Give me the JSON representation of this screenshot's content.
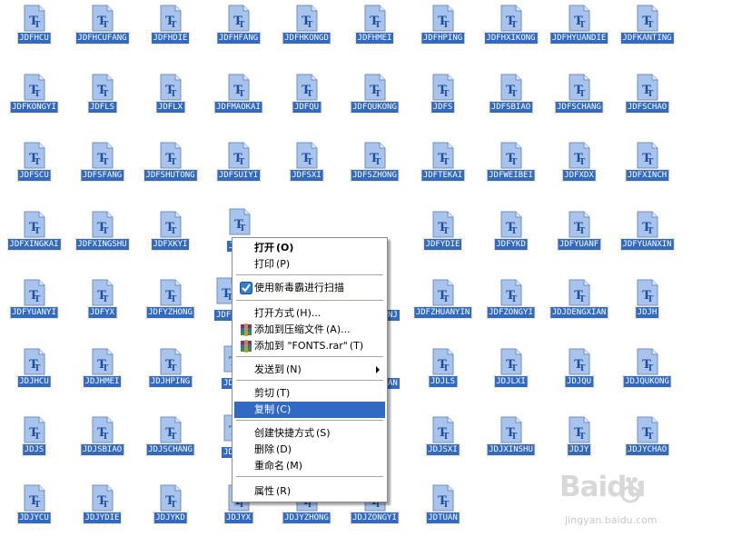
{
  "desktop": {
    "rows": [
      [
        "JDFHCU",
        "JDFHCUFANG",
        "JDFHDIE",
        "JDFHFANG",
        "JDFHKONGD",
        "JDFHMEI",
        "JDFHPING",
        "JDFHXIKONG",
        "JDFHYUANDIE",
        "JDFKANTING"
      ],
      [
        "JDFKONGYI",
        "JDFLS",
        "JDFLX",
        "JDFMAOKAI",
        "JDFQU",
        "JDFQUKONG",
        "JDFS",
        "JDFSBIAO",
        "JDFSCHANG",
        "JDFSCHAO"
      ],
      [
        "JDFSCU",
        "JDFSFANG",
        "JDFSHUTONG",
        "JDFSUIYI",
        "JDFSXI",
        "JDFSZHONG",
        "JDFTEKAI",
        "JDFWEIBEI",
        "JDFXDX",
        "JDFXINCH"
      ],
      [
        "JDFXINGKAI",
        "JDFXINGSHU",
        "JDFXKYI",
        "",
        "",
        "",
        "JDFYDIE",
        "JDFYKD",
        "JDFYUANF",
        "JDFYUANXIN"
      ],
      [
        "JDFYUANYI",
        "JDFYX",
        "JDFYZHONG",
        "",
        "",
        "",
        "JDFZHUANYIN",
        "JDFZONGYI",
        "JDJDENGXIAN",
        "JDJH"
      ],
      [
        "JDJHCU",
        "JDJHMEI",
        "JDJHPING",
        "",
        "",
        "",
        "JDJLS",
        "JDJLXI",
        "JDJQU",
        "JDJQUKONG"
      ],
      [
        "JDJS",
        "JDJSBIAO",
        "JDJSCHANG",
        "",
        "",
        "",
        "JDJSXI",
        "JDJXINSHU",
        "JDJY",
        "JDJYCHAO"
      ],
      [
        "JDJYCU",
        "JDJYDIE",
        "JDJYKD",
        "JDJYX",
        "JDJYZHONG",
        "JDJZONGYI",
        "JDTUAN",
        "",
        "",
        ""
      ]
    ],
    "partial_labels": [
      {
        "text": "JD"
      },
      {
        "text": "JDFZ"
      },
      {
        "text": "NJ"
      },
      {
        "text": "JD"
      },
      {
        "text": "AN"
      },
      {
        "text": "JD"
      }
    ]
  },
  "context_menu": {
    "items": [
      {
        "label": "打开",
        "key": "(O)",
        "bold": true,
        "icon": ""
      },
      {
        "label": "打印",
        "key": "(P)",
        "icon": ""
      },
      {
        "label": "使用新毒霸进行扫描",
        "key": "",
        "icon": "antivirus-scan-icon"
      },
      {
        "label": "打开方式",
        "key": "(H)...",
        "icon": ""
      },
      {
        "label": "添加到压缩文件",
        "key": "(A)...",
        "icon": "winrar-icon"
      },
      {
        "label": "添加到 \"FONTS.rar\"",
        "key": "(T)",
        "icon": "winrar-icon"
      },
      {
        "label": "发送到",
        "key": "(N)",
        "icon": "",
        "submenu": true
      },
      {
        "label": "剪切",
        "key": "(T)",
        "icon": ""
      },
      {
        "label": "复制",
        "key": "(C)",
        "icon": "",
        "highlight": true
      },
      {
        "label": "创建快捷方式",
        "key": "(S)",
        "icon": ""
      },
      {
        "label": "删除",
        "key": "(D)",
        "icon": ""
      },
      {
        "label": "重命名",
        "key": "(M)",
        "icon": ""
      },
      {
        "label": "属性",
        "key": "(R)",
        "icon": ""
      }
    ]
  },
  "watermark": {
    "logo": "Baidu",
    "url": "jingyan.baidu.com"
  },
  "colors": {
    "selection": "#316ac5",
    "icon_fill": "#a8c4ec",
    "icon_letter": "#1f4fa0"
  }
}
